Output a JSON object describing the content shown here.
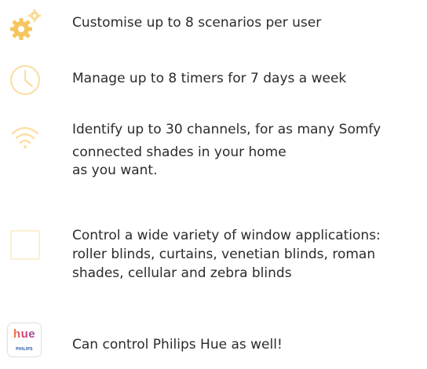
{
  "features": [
    {
      "icon": "gear-icon",
      "lines": [
        "Customise up to 8 scenarios per user"
      ]
    },
    {
      "icon": "clock-icon",
      "lines": [
        "Manage up to 8 timers for 7 days a week"
      ]
    },
    {
      "icon": "wifi-icon",
      "lines": [
        "Identify up to 30 channels, for as many Somfy",
        "connected shades in your home",
        "as you want."
      ]
    },
    {
      "icon": "window-frame-icon",
      "lines": [
        "Control a wide variety of window applications:",
        "roller blinds, curtains, venetian blinds, roman",
        "shades, cellular and zebra blinds"
      ]
    },
    {
      "icon": "hue-app-icon",
      "logo_text": "hue",
      "logo_subtext": "PHILIPS",
      "lines": [
        "Can control Philips Hue as well!"
      ]
    }
  ],
  "colors": {
    "icon_accent": "#f7c560",
    "icon_light": "#fbe3b0",
    "text": "#2b2b2b"
  }
}
